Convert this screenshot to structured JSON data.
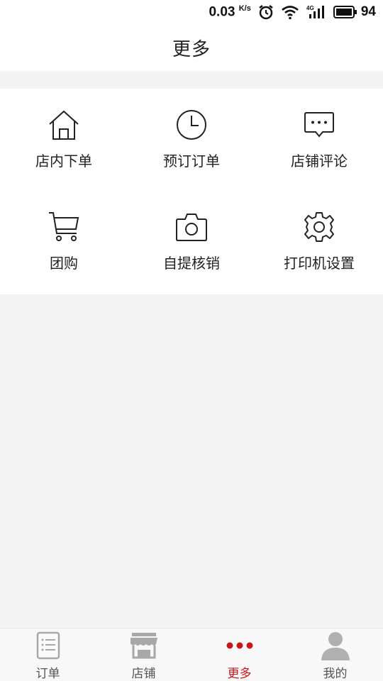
{
  "status_bar": {
    "speed_value": "0.03",
    "speed_unit": "K/s",
    "network_label": "4G",
    "battery_level": "94"
  },
  "header": {
    "title": "更多"
  },
  "grid": {
    "items": [
      {
        "label": "店内下单",
        "icon": "home-icon"
      },
      {
        "label": "预订订单",
        "icon": "clock-icon"
      },
      {
        "label": "店铺评论",
        "icon": "comment-icon"
      },
      {
        "label": "团购",
        "icon": "cart-icon"
      },
      {
        "label": "自提核销",
        "icon": "camera-icon"
      },
      {
        "label": "打印机设置",
        "icon": "gear-icon"
      }
    ]
  },
  "tab_bar": {
    "active_color": "#c8161d",
    "tabs": [
      {
        "label": "订单",
        "icon": "order-list-icon",
        "active": false
      },
      {
        "label": "店铺",
        "icon": "store-icon",
        "active": false
      },
      {
        "label": "更多",
        "icon": "more-dots-icon",
        "active": true
      },
      {
        "label": "我的",
        "icon": "user-icon",
        "active": false
      }
    ]
  }
}
